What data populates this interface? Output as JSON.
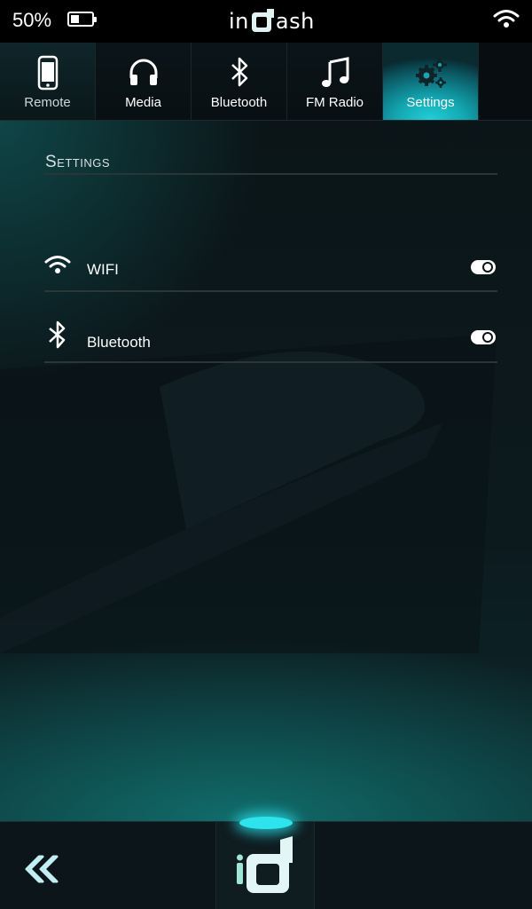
{
  "status_bar": {
    "battery_text": "50%",
    "battery_level": 0.5,
    "logo_left": "in",
    "logo_right": "ash",
    "wifi_icon": "wifi-icon"
  },
  "tabs": [
    {
      "label": "Remote",
      "icon": "phone-icon",
      "active": false
    },
    {
      "label": "Media",
      "icon": "headphones-icon",
      "active": false
    },
    {
      "label": "Bluetooth",
      "icon": "bluetooth-icon",
      "active": false
    },
    {
      "label": "FM Radio",
      "icon": "music-note-icon",
      "active": false
    },
    {
      "label": "Settings",
      "icon": "gears-icon",
      "active": true
    }
  ],
  "main": {
    "section_title": "Settings",
    "settings": [
      {
        "label": "WIFI",
        "icon": "wifi-icon",
        "enabled": true
      },
      {
        "label": "Bluetooth",
        "icon": "bluetooth-icon",
        "enabled": true
      }
    ]
  },
  "bottom_bar": {
    "back_icon": "double-chevron-left-icon",
    "home_logo": "indash-logo"
  },
  "colors": {
    "accent": "#14b8c2",
    "glow": "#2ee4ec",
    "background": "#0b1518"
  }
}
